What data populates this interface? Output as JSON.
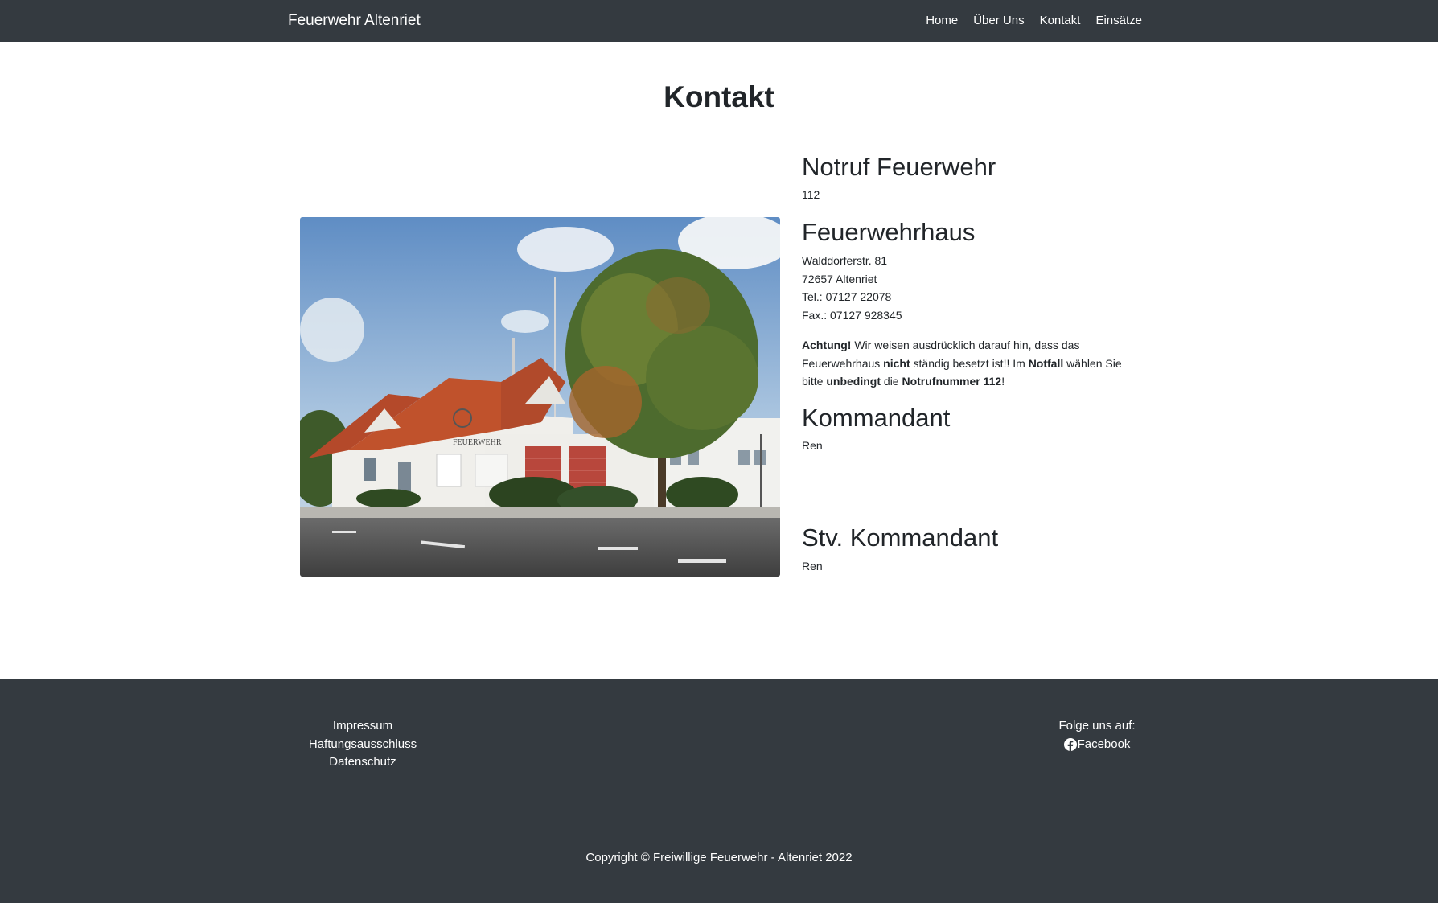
{
  "navbar": {
    "brand": "Feuerwehr Altenriet",
    "items": [
      {
        "label": "Home"
      },
      {
        "label": "Über Uns"
      },
      {
        "label": "Kontakt"
      },
      {
        "label": "Einsätze"
      }
    ]
  },
  "page": {
    "title": "Kontakt"
  },
  "photo": {
    "building_sign": "FEUERWEHR"
  },
  "contact": {
    "notruf": {
      "heading": "Notruf Feuerwehr",
      "number": "112"
    },
    "haus": {
      "heading": "Feuerwehrhaus",
      "street": "Walddorferstr. 81",
      "city": "72657 Altenriet",
      "tel": "Tel.: 07127 22078",
      "fax": "Fax.: 07127 928345"
    },
    "notice": {
      "w1": "Achtung!",
      "t1": " Wir weisen ausdrücklich darauf hin, dass das Feuerwehrhaus ",
      "w2": "nicht",
      "t2": " ständig besetzt ist!! Im ",
      "w3": "Notfall",
      "t3": " wählen Sie bitte ",
      "w4": "unbedingt",
      "t4": " die ",
      "w5": "Notrufnummer 112",
      "t5": "!"
    },
    "kommandant": {
      "heading": "Kommandant",
      "name": "Ren"
    },
    "stv_kommandant": {
      "heading": "Stv. Kommandant",
      "name": "Ren"
    }
  },
  "footer": {
    "links": [
      {
        "label": "Impressum"
      },
      {
        "label": "Haftungsausschluss"
      },
      {
        "label": "Datenschutz"
      }
    ],
    "follow_label": "Folge uns auf:",
    "facebook_label": "Facebook",
    "copyright": "Copyright © Freiwillige Feuerwehr - Altenriet 2022"
  },
  "colors": {
    "navbar_bg": "#343a40",
    "footer_bg": "#343a40",
    "text": "#212529",
    "link": "#ffffff"
  }
}
